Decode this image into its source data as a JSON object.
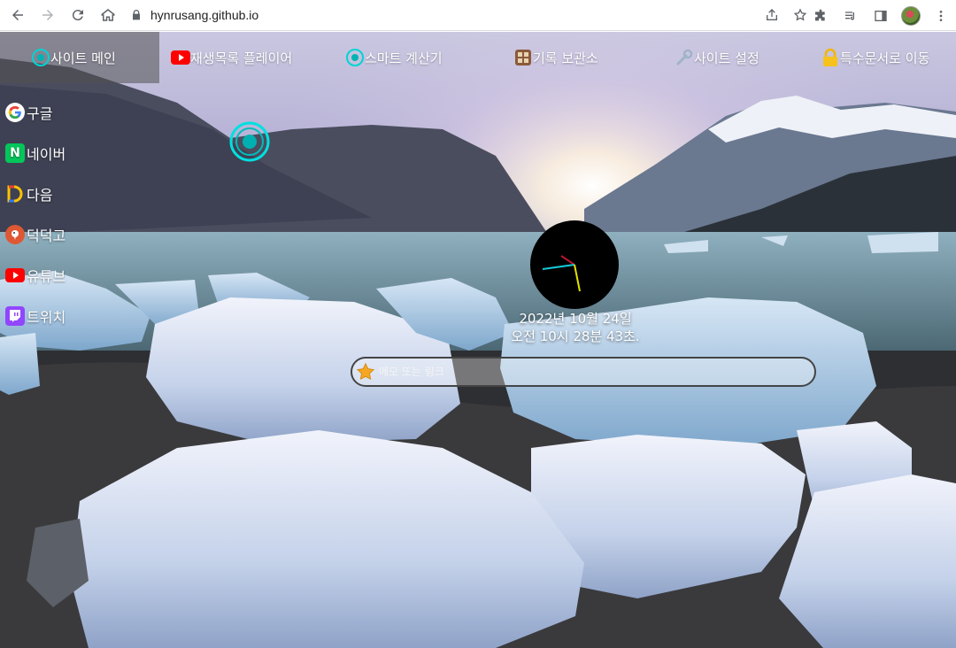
{
  "browser": {
    "url": "hynrusang.github.io"
  },
  "top_menu": [
    {
      "label": "사이트 메인",
      "icon": "ring-icon"
    },
    {
      "label": "재생목록 플레이어",
      "icon": "youtube-icon"
    },
    {
      "label": "스마트 계산기",
      "icon": "ring-icon"
    },
    {
      "label": "기록 보관소",
      "icon": "archive-icon"
    },
    {
      "label": "사이트 설정",
      "icon": "wrench-icon"
    },
    {
      "label": "특수문서로 이동",
      "icon": "lock-icon"
    }
  ],
  "side_menu": [
    {
      "label": "구글",
      "icon": "google-icon",
      "color": "#ffffff"
    },
    {
      "label": "네이버",
      "icon": "naver-icon",
      "color": "#03c75a"
    },
    {
      "label": "다음",
      "icon": "daum-icon",
      "color": "#ffffff"
    },
    {
      "label": "덕덕고",
      "icon": "duckduckgo-icon",
      "color": "#de5833"
    },
    {
      "label": "유튜브",
      "icon": "youtube-icon",
      "color": "#ff0000"
    },
    {
      "label": "트위치",
      "icon": "twitch-icon",
      "color": "#9146ff"
    }
  ],
  "clock": {
    "date": "2022년 10월 24일",
    "time": "오전 10시 28분 43초."
  },
  "search": {
    "placeholder": "메모 또는 링크"
  },
  "colors": {
    "accent": "#00c8c8",
    "star": "#f5a623"
  }
}
